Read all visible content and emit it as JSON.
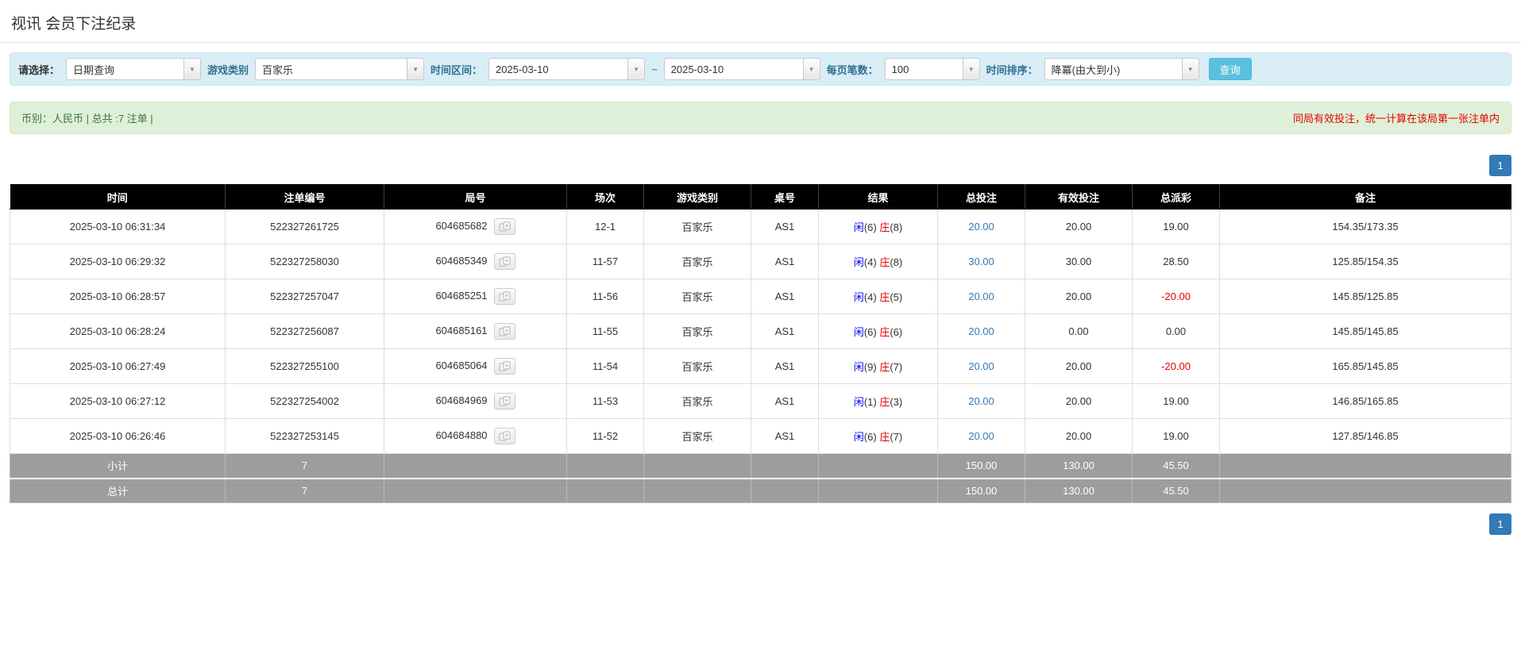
{
  "page": {
    "title": "视讯 会员下注纪录"
  },
  "filters": {
    "select": {
      "label": "请选择：",
      "value": "日期查询"
    },
    "game_type": {
      "label": "游戏类别",
      "value": "百家乐"
    },
    "date_range": {
      "label": "时间区间：",
      "from": "2025-03-10",
      "separator": "~",
      "to": "2025-03-10"
    },
    "page_size": {
      "label": "每页笔数：",
      "value": "100"
    },
    "sort": {
      "label": "时间排序：",
      "value": "降冪(由大到小)"
    },
    "search_button": "查询"
  },
  "summary": {
    "currency_info": "币别：人民币 | 总共 :7 注单 |",
    "notice": "同局有效投注，统一计算在该局第一张注单内"
  },
  "pagination": {
    "current_page": "1"
  },
  "table": {
    "headers": [
      "时间",
      "注单编号",
      "局号",
      "场次",
      "游戏类别",
      "桌号",
      "结果",
      "总投注",
      "有效投注",
      "总派彩",
      "备注"
    ],
    "rows": [
      {
        "time": "2025-03-10 06:31:34",
        "bet_id": "522327261725",
        "round_id": "604685682",
        "session": "12-1",
        "game": "百家乐",
        "table_no": "AS1",
        "player": "闲",
        "player_score": "(6)",
        "banker": "庄",
        "banker_score": "(8)",
        "total_bet": "20.00",
        "valid_bet": "20.00",
        "payout": "19.00",
        "remark": "154.35/173.35"
      },
      {
        "time": "2025-03-10 06:29:32",
        "bet_id": "522327258030",
        "round_id": "604685349",
        "session": "11-57",
        "game": "百家乐",
        "table_no": "AS1",
        "player": "闲",
        "player_score": "(4)",
        "banker": "庄",
        "banker_score": "(8)",
        "total_bet": "30.00",
        "valid_bet": "30.00",
        "payout": "28.50",
        "remark": "125.85/154.35"
      },
      {
        "time": "2025-03-10 06:28:57",
        "bet_id": "522327257047",
        "round_id": "604685251",
        "session": "11-56",
        "game": "百家乐",
        "table_no": "AS1",
        "player": "闲",
        "player_score": "(4)",
        "banker": "庄",
        "banker_score": "(5)",
        "total_bet": "20.00",
        "valid_bet": "20.00",
        "payout": "-20.00",
        "remark": "145.85/125.85"
      },
      {
        "time": "2025-03-10 06:28:24",
        "bet_id": "522327256087",
        "round_id": "604685161",
        "session": "11-55",
        "game": "百家乐",
        "table_no": "AS1",
        "player": "闲",
        "player_score": "(6)",
        "banker": "庄",
        "banker_score": "(6)",
        "total_bet": "20.00",
        "valid_bet": "0.00",
        "payout": "0.00",
        "remark": "145.85/145.85"
      },
      {
        "time": "2025-03-10 06:27:49",
        "bet_id": "522327255100",
        "round_id": "604685064",
        "session": "11-54",
        "game": "百家乐",
        "table_no": "AS1",
        "player": "闲",
        "player_score": "(9)",
        "banker": "庄",
        "banker_score": "(7)",
        "total_bet": "20.00",
        "valid_bet": "20.00",
        "payout": "-20.00",
        "remark": "165.85/145.85"
      },
      {
        "time": "2025-03-10 06:27:12",
        "bet_id": "522327254002",
        "round_id": "604684969",
        "session": "11-53",
        "game": "百家乐",
        "table_no": "AS1",
        "player": "闲",
        "player_score": "(1)",
        "banker": "庄",
        "banker_score": "(3)",
        "total_bet": "20.00",
        "valid_bet": "20.00",
        "payout": "19.00",
        "remark": "146.85/165.85"
      },
      {
        "time": "2025-03-10 06:26:46",
        "bet_id": "522327253145",
        "round_id": "604684880",
        "session": "11-52",
        "game": "百家乐",
        "table_no": "AS1",
        "player": "闲",
        "player_score": "(6)",
        "banker": "庄",
        "banker_score": "(7)",
        "total_bet": "20.00",
        "valid_bet": "20.00",
        "payout": "19.00",
        "remark": "127.85/146.85"
      }
    ],
    "footer": {
      "subtotal": {
        "label": "小计",
        "count": "7",
        "total_bet": "150.00",
        "valid_bet": "130.00",
        "payout": "45.50"
      },
      "total": {
        "label": "总计",
        "count": "7",
        "total_bet": "150.00",
        "valid_bet": "130.00",
        "payout": "45.50"
      }
    }
  },
  "colors": {
    "header_bg": "#000000",
    "footer_bg": "#9d9d9d",
    "link_blue": "#337ab7",
    "player_blue": "#0000ee",
    "banker_red": "#e60000",
    "negative_red": "#e60000",
    "search_button_blue": "#5bc0de",
    "pagination_blue": "#337ab7",
    "filter_bar_bg": "#d9edf7",
    "summary_bar_bg": "#dff0d8",
    "summary_text_green": "#3c763d",
    "notice_red": "#e60000"
  }
}
